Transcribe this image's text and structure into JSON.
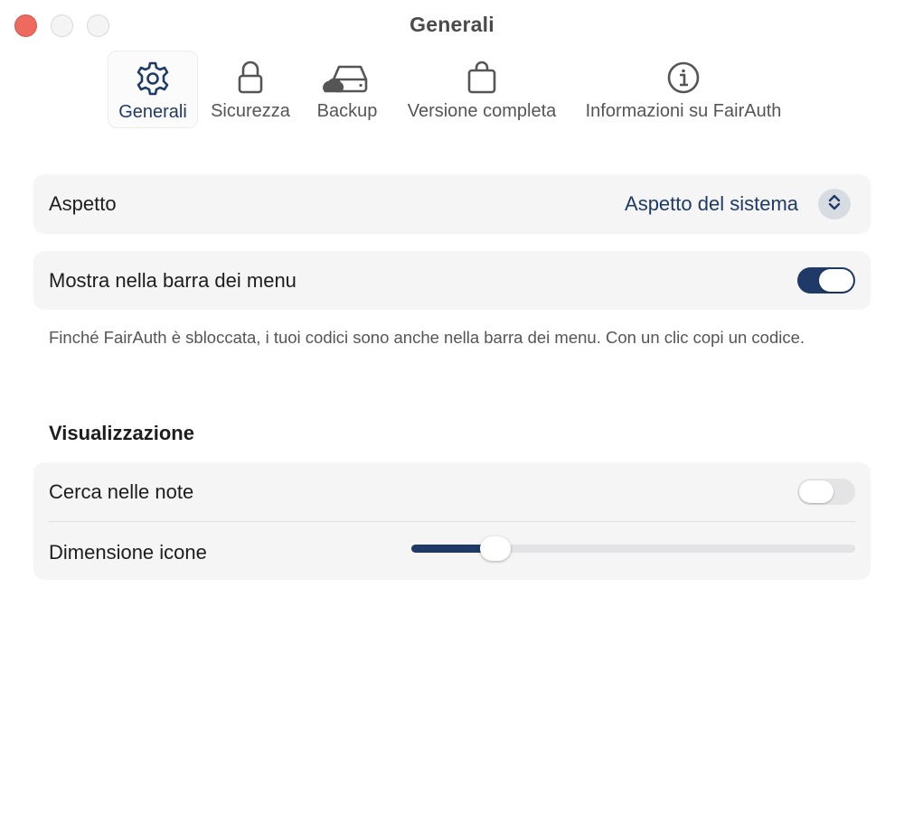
{
  "window": {
    "title": "Generali"
  },
  "toolbar": {
    "tabs": [
      {
        "id": "generali",
        "label": "Generali",
        "icon": "gear-icon",
        "active": true
      },
      {
        "id": "sicurezza",
        "label": "Sicurezza",
        "icon": "lock-icon",
        "active": false
      },
      {
        "id": "backup",
        "label": "Backup",
        "icon": "cloud-drive-icon",
        "active": false
      },
      {
        "id": "versione",
        "label": "Versione completa",
        "icon": "shopping-bag-icon",
        "active": false
      },
      {
        "id": "info",
        "label": "Informazioni su FairAuth",
        "icon": "info-circle-icon",
        "active": false
      }
    ]
  },
  "appearance": {
    "label": "Aspetto",
    "value": "Aspetto del sistema"
  },
  "menubar": {
    "label": "Mostra nella barra dei menu",
    "enabled": true,
    "note": "Finché FairAuth è sbloccata, i tuoi codici sono anche nella barra dei menu. Con un clic copi un codice."
  },
  "display": {
    "section_title": "Visualizzazione",
    "search_notes": {
      "label": "Cerca nelle note",
      "enabled": false
    },
    "icon_size": {
      "label": "Dimensione icone",
      "fraction": 0.19
    }
  },
  "colors": {
    "accent": "#1f3a66",
    "close_light": "#ee6a5f"
  }
}
